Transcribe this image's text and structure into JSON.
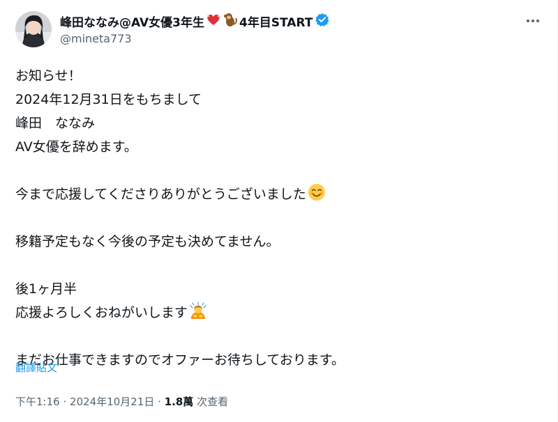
{
  "author": {
    "display_name": "峰田ななみ@AV女優3年生",
    "name_suffix": "4年目START",
    "handle": "@mineta773",
    "verified": true
  },
  "tweet": {
    "lines": [
      "お知らせ！",
      "2024年12月31日をもちまして",
      "峰田　ななみ",
      "AV女優を辞めます。",
      "",
      "今まで応援してくださりありがとうございました",
      "",
      "移籍予定もなく今後の予定も決めてません。",
      "",
      "後1ヶ月半",
      "応援よろしくおねがいします",
      "",
      "まだお仕事できますのでオファーお待ちしております。"
    ]
  },
  "translate_label": "翻譯貼文",
  "meta": {
    "time": "下午1:16",
    "separator": "·",
    "date": "2024年10月21日",
    "views_count": "1.8萬",
    "views_label": "次查看"
  },
  "icons": {
    "more": "more-horizontal-icon",
    "verified": "verified-badge-icon",
    "heart": "heart-ribbon-emoji",
    "monkey": "monkey-emoji",
    "smile": "smiling-face-emoji",
    "bow": "person-bowing-emoji"
  },
  "colors": {
    "link": "#1d9bf0",
    "secondary": "#536471",
    "primary": "#0f1419"
  }
}
